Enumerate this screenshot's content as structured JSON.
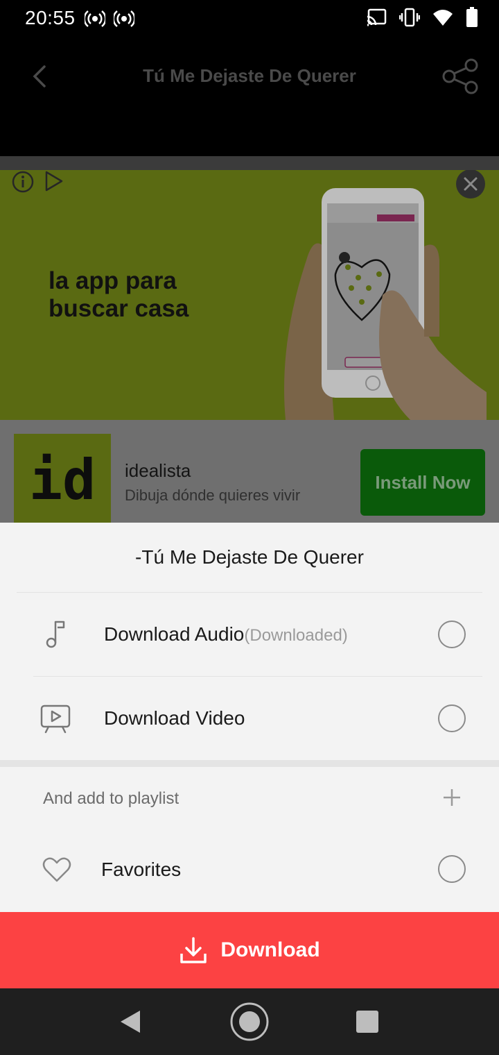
{
  "status_bar": {
    "time": "20:55",
    "left_icons": [
      "radio-waves-icon",
      "radio-waves-icon"
    ],
    "right_icons": [
      "cast-icon",
      "vibrate-icon",
      "wifi-icon",
      "battery-icon"
    ]
  },
  "header": {
    "title": "Tú Me Dejaste De Querer",
    "back_icon": "back-arrow-icon",
    "share_icon": "share-icon"
  },
  "ad": {
    "headline": "la app para\nbuscar casa",
    "advertiser": "idealista",
    "tagline": "Dibuja dónde quieres vivir",
    "logo_text": "id",
    "install_label": "Install Now",
    "colors": {
      "banner": "#5a6a12",
      "install": "#0a5a0a"
    }
  },
  "sheet": {
    "title": "-Tú Me Dejaste De Querer",
    "options": [
      {
        "label": "Download Audio",
        "suffix": "(Downloaded)",
        "icon": "music-note-icon"
      },
      {
        "label": "Download Video",
        "suffix": "",
        "icon": "video-screen-icon"
      }
    ],
    "playlist_label": "And add to playlist",
    "playlists": [
      {
        "label": "Favorites",
        "icon": "heart-icon"
      }
    ],
    "download_label": "Download",
    "colors": {
      "accent": "#fc4243"
    }
  },
  "nav_bar": {
    "icons": [
      "nav-back-icon",
      "nav-home-icon",
      "nav-recent-icon"
    ]
  }
}
